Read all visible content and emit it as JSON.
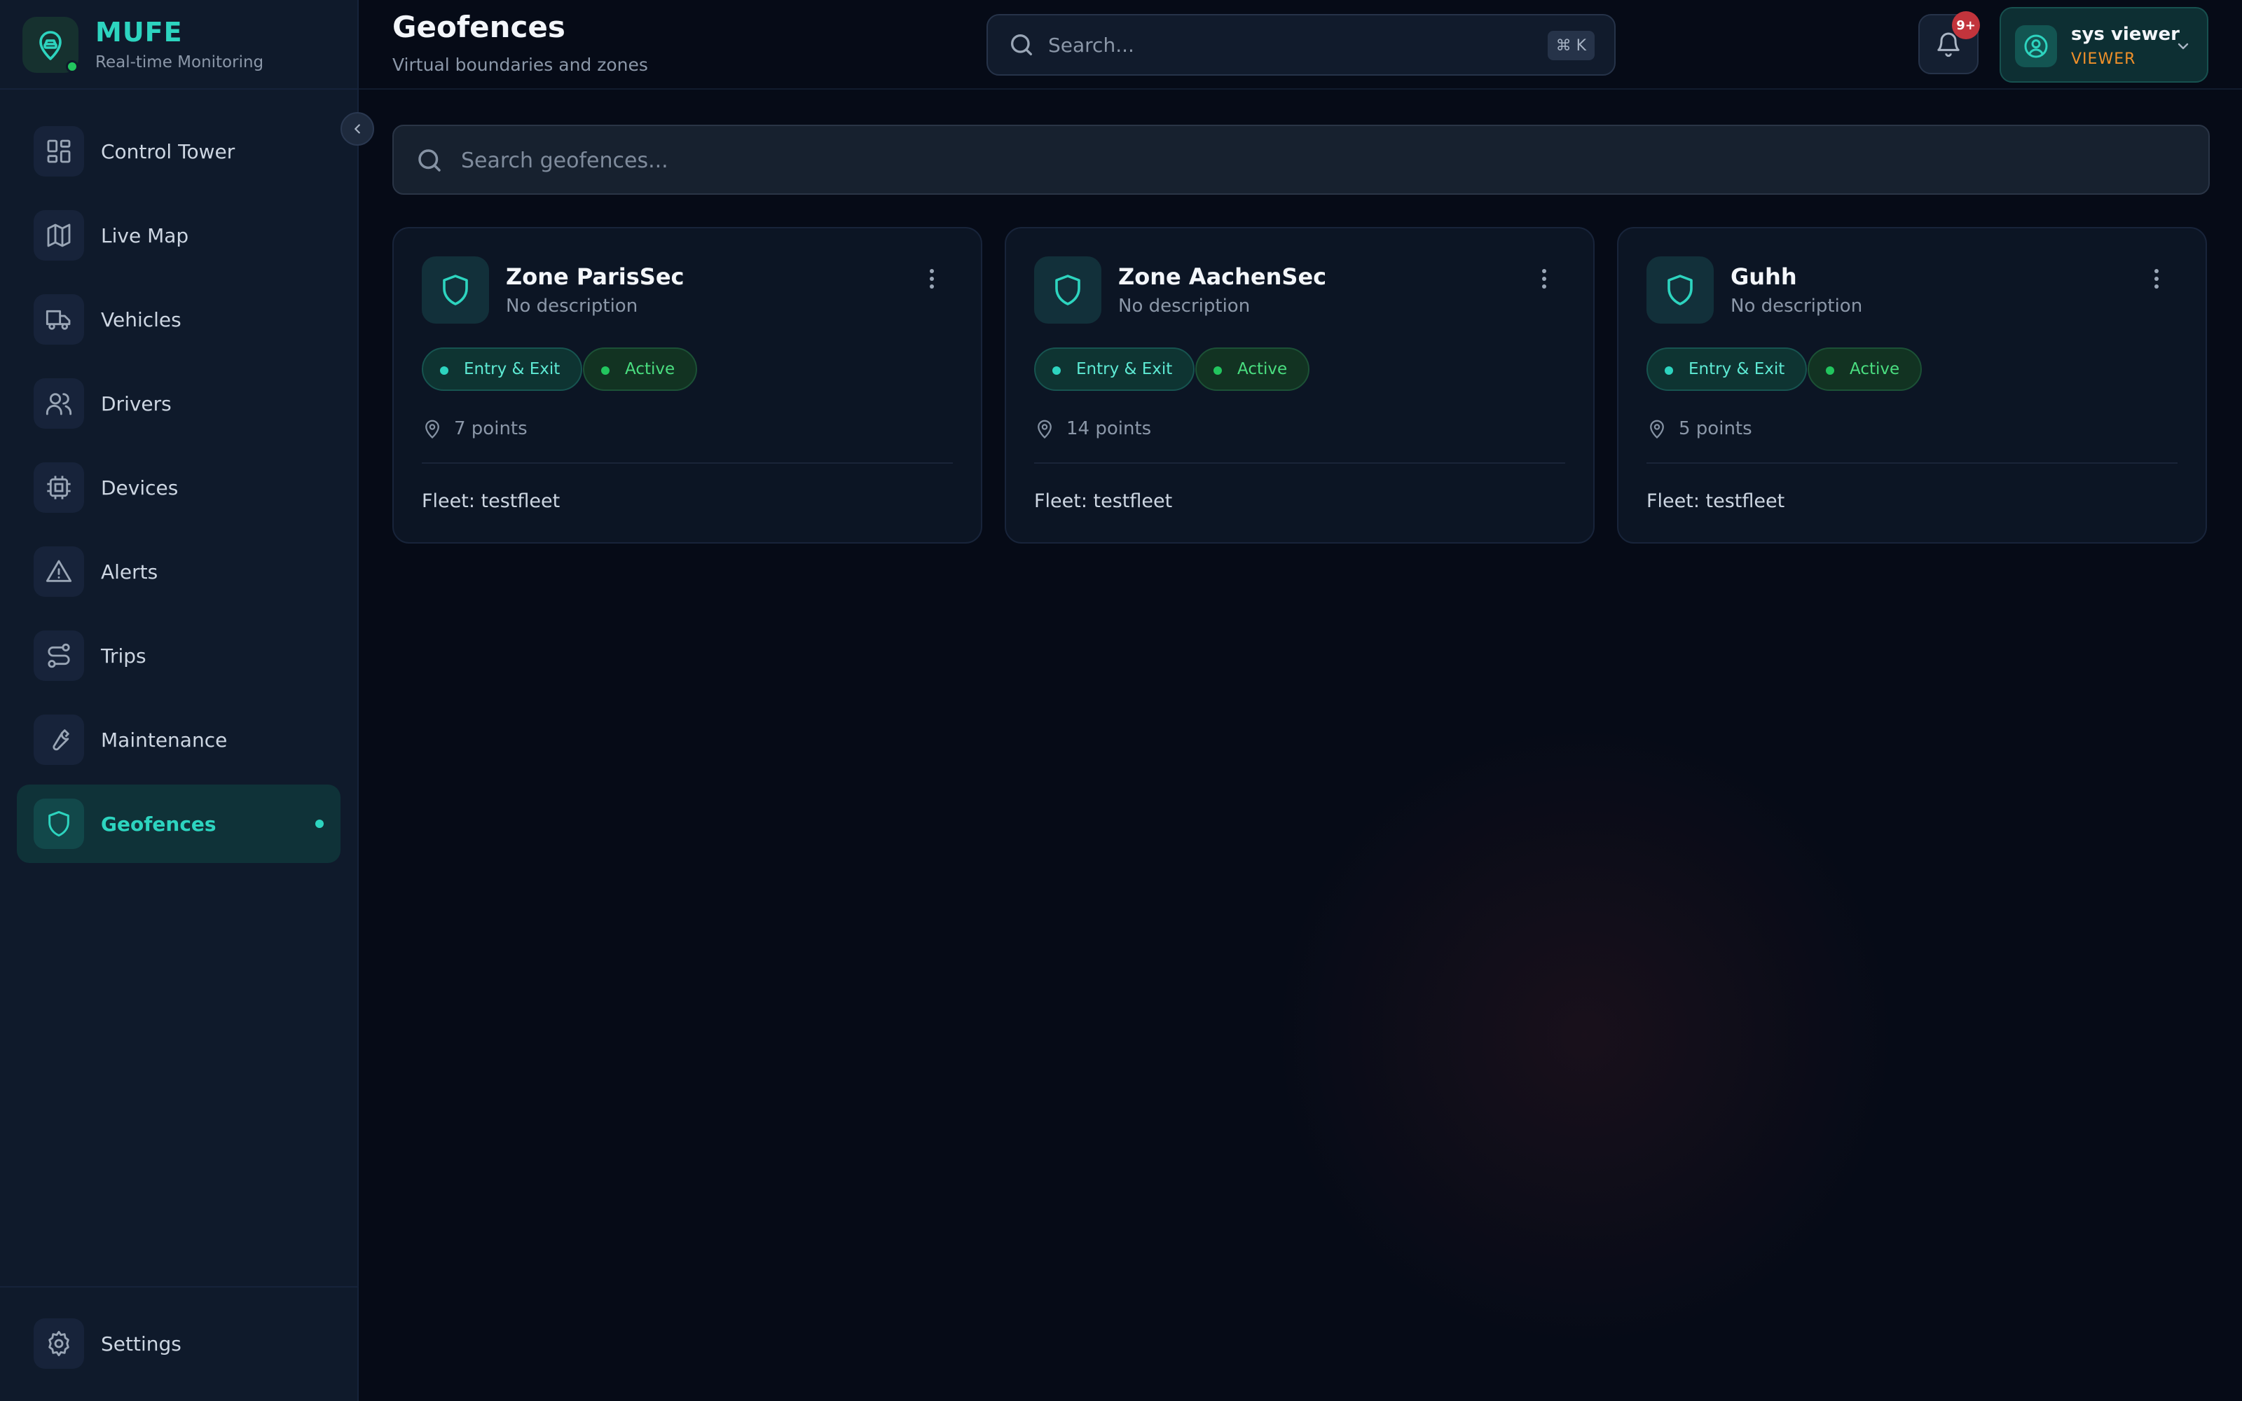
{
  "brand": {
    "name": "MUFE",
    "tagline": "Real-time Monitoring"
  },
  "sidebar": {
    "items": [
      {
        "label": "Control Tower",
        "icon": "grid-icon"
      },
      {
        "label": "Live Map",
        "icon": "map-icon"
      },
      {
        "label": "Vehicles",
        "icon": "truck-icon"
      },
      {
        "label": "Drivers",
        "icon": "users-icon"
      },
      {
        "label": "Devices",
        "icon": "chip-icon"
      },
      {
        "label": "Alerts",
        "icon": "warning-icon"
      },
      {
        "label": "Trips",
        "icon": "route-icon"
      },
      {
        "label": "Maintenance",
        "icon": "wrench-icon"
      },
      {
        "label": "Geofences",
        "icon": "shield-icon",
        "active": true
      }
    ],
    "settings_label": "Settings"
  },
  "header": {
    "title": "Geofences",
    "subtitle": "Virtual boundaries and zones",
    "search_placeholder": "Search...",
    "search_shortcut": "⌘ K",
    "notification_badge": "9+",
    "user": {
      "name": "sys viewer",
      "role": "VIEWER"
    }
  },
  "main": {
    "search_placeholder": "Search geofences...",
    "geofences": [
      {
        "name": "Zone ParisSec",
        "description": "No description",
        "type": "Entry & Exit",
        "status": "Active",
        "points": "7 points",
        "fleet": "Fleet: testfleet"
      },
      {
        "name": "Zone AachenSec",
        "description": "No description",
        "type": "Entry & Exit",
        "status": "Active",
        "points": "14 points",
        "fleet": "Fleet: testfleet"
      },
      {
        "name": "Guhh",
        "description": "No description",
        "type": "Entry & Exit",
        "status": "Active",
        "points": "5 points",
        "fleet": "Fleet: testfleet"
      }
    ]
  },
  "colors": {
    "accent": "#2dd4bf",
    "active_green": "#22c55e",
    "role": "#f0902a",
    "badge": "#c2343c"
  }
}
